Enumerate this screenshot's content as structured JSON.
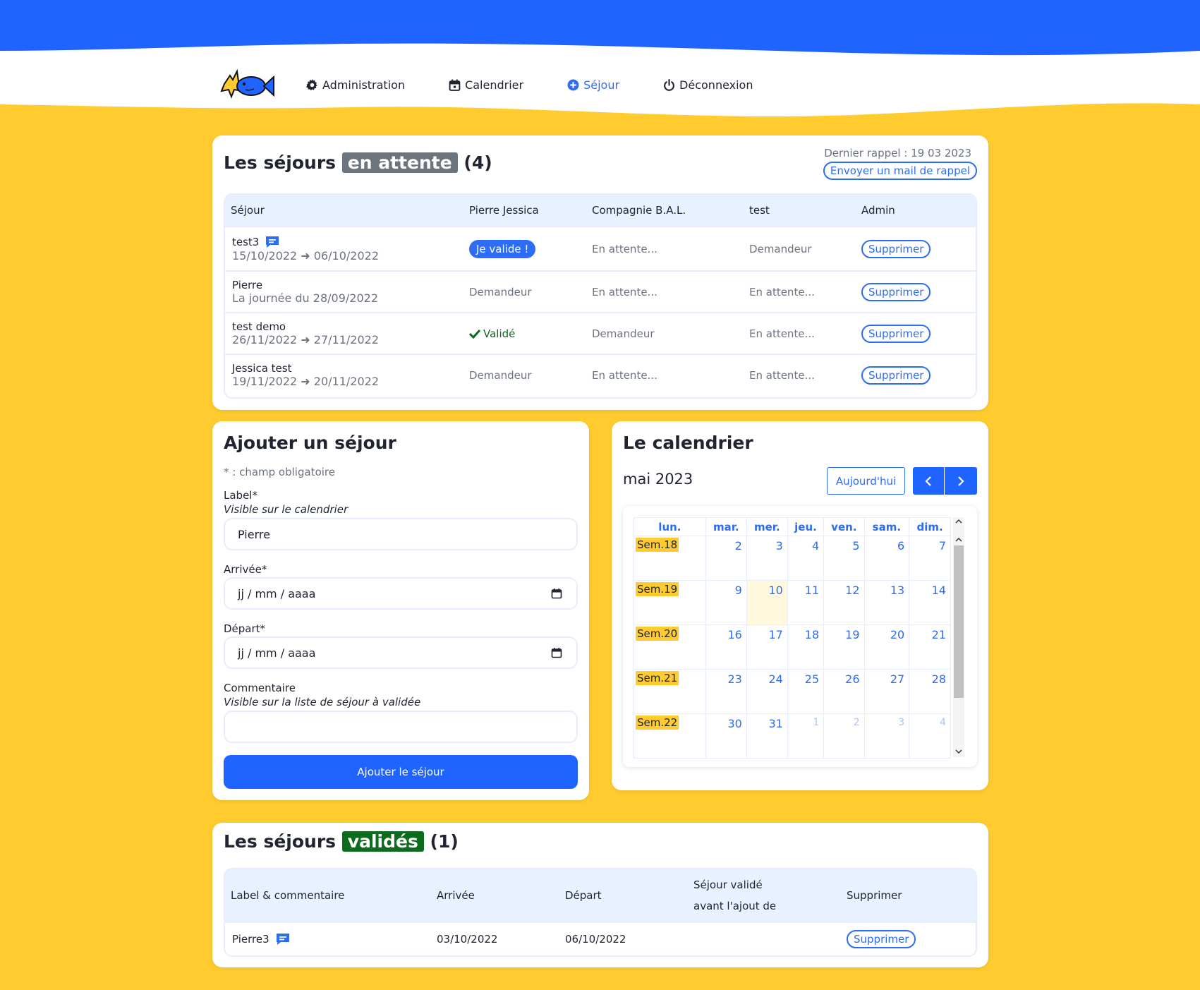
{
  "colors": {
    "primary": "#2d6cf5",
    "yellow": "#ffcb2f",
    "grey_badge": "#6c757d",
    "green_badge": "#0c6b1d",
    "valid_green": "#0c6b1d"
  },
  "nav": {
    "items": [
      {
        "label": "Administration",
        "icon": "gear-icon"
      },
      {
        "label": "Calendrier",
        "icon": "calendar-icon"
      },
      {
        "label": "Séjour",
        "icon": "plus-circle-icon",
        "active": true
      },
      {
        "label": "Déconnexion",
        "icon": "power-icon"
      }
    ]
  },
  "pending": {
    "title_prefix": "Les séjours",
    "title_badge": "en attente",
    "title_count": "(4)",
    "reminder": "Dernier rappel : 19 03 2023",
    "reminder_button": "Envoyer un mail de rappel",
    "columns": [
      "Séjour",
      "Pierre Jessica",
      "Compagnie B.A.L.",
      "test",
      "Admin"
    ],
    "rows": [
      {
        "label": "test3",
        "dates": "15/10/2022 ➜ 06/10/2022",
        "has_comment": true,
        "c1": "Je valide !",
        "c2": "En attente...",
        "c3": "Demandeur",
        "action": "Supprimer"
      },
      {
        "label": "Pierre",
        "dates": "La journée du 28/09/2022",
        "c1": "Demandeur",
        "c2": "En attente...",
        "c3": "En attente...",
        "action": "Supprimer"
      },
      {
        "label": "test demo",
        "dates": "26/11/2022 ➜ 27/11/2022",
        "c1": "Validé",
        "c2": "Demandeur",
        "c3": "En attente...",
        "action": "Supprimer"
      },
      {
        "label": "Jessica test",
        "dates": "19/11/2022 ➜ 20/11/2022",
        "c1": "Demandeur",
        "c2": "En attente...",
        "c3": "En attente...",
        "action": "Supprimer"
      }
    ]
  },
  "form": {
    "title": "Ajouter un séjour",
    "required_note": "* : champ obligatoire",
    "label_label": "Label*",
    "label_hint": "Visible sur le calendrier",
    "label_value": "Pierre",
    "arrival_label": "Arrivée*",
    "arrival_value": "jj / mm / aaaa",
    "departure_label": "Départ*",
    "departure_value": "jj / mm / aaaa",
    "comment_label": "Commentaire",
    "comment_hint": "Visible sur la liste de séjour à validée",
    "comment_value": "",
    "submit": "Ajouter le séjour"
  },
  "calendar": {
    "title": "Le calendrier",
    "month": "mai 2023",
    "today_button": "Aujourd'hui",
    "days": [
      "lun.",
      "mar.",
      "mer.",
      "jeu.",
      "ven.",
      "sam.",
      "dim."
    ],
    "weeks": [
      {
        "label": "Sem.18",
        "days": [
          "2",
          "3",
          "4",
          "5",
          "6",
          "7"
        ]
      },
      {
        "label": "Sem.19",
        "days": [
          "9",
          "10",
          "11",
          "12",
          "13",
          "14"
        ]
      },
      {
        "label": "Sem.20",
        "days": [
          "16",
          "17",
          "18",
          "19",
          "20",
          "21"
        ]
      },
      {
        "label": "Sem.21",
        "days": [
          "23",
          "24",
          "25",
          "26",
          "27",
          "28"
        ]
      },
      {
        "label": "Sem.22",
        "days": [
          "30",
          "31",
          "1",
          "2",
          "3",
          "4"
        ]
      }
    ]
  },
  "validated": {
    "title_prefix": "Les séjours",
    "title_badge": "validés",
    "title_count": "(1)",
    "columns": [
      "Label & commentaire",
      "Arrivée",
      "Départ",
      "Séjour validé",
      "avant l'ajout de",
      "Supprimer"
    ],
    "rows": [
      {
        "label": "Pierre3",
        "has_comment": true,
        "arrival": "03/10/2022",
        "departure": "06/10/2022",
        "validated_before": "",
        "action": "Supprimer"
      }
    ]
  }
}
